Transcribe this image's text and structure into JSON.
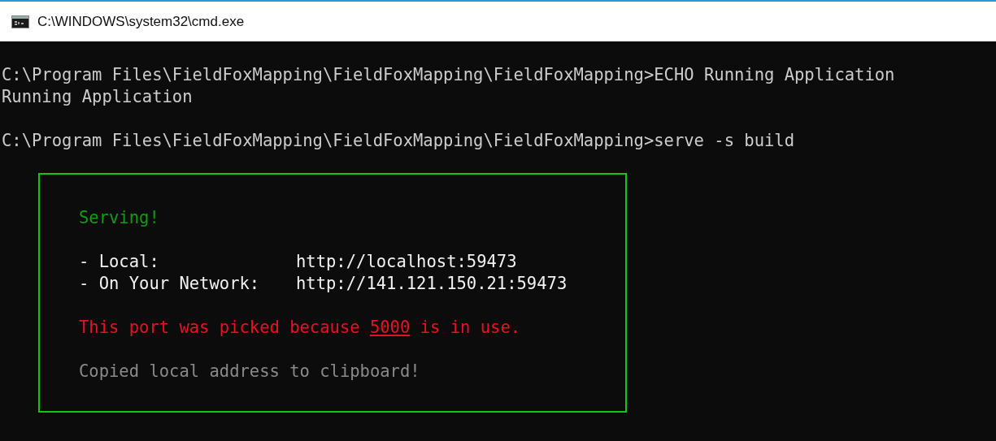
{
  "window": {
    "title": "C:\\WINDOWS\\system32\\cmd.exe"
  },
  "console_lines": [
    {
      "kind": "prompt",
      "prompt": "C:\\Program Files\\FieldFoxMapping\\FieldFoxMapping\\FieldFoxMapping>",
      "command": "ECHO Running Application"
    },
    {
      "kind": "output",
      "text": "Running Application"
    },
    {
      "kind": "blank"
    },
    {
      "kind": "prompt",
      "prompt": "C:\\Program Files\\FieldFoxMapping\\FieldFoxMapping\\FieldFoxMapping>",
      "command": "serve -s build"
    }
  ],
  "serve_box": {
    "heading": "Serving!",
    "addresses": [
      {
        "label": "- Local:",
        "url": "http://localhost:59473"
      },
      {
        "label": "- On Your Network:",
        "url": "http://141.121.150.21:59473"
      }
    ],
    "warning": {
      "before": "This port was picked because ",
      "port": "5000",
      "after": " is in use."
    },
    "note": "Copied local address to clipboard!"
  }
}
